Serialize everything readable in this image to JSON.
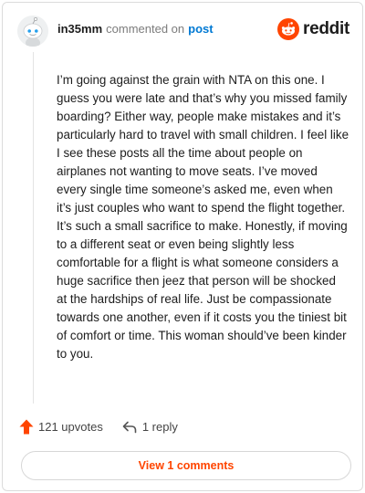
{
  "comment": {
    "username": "in35mm",
    "action_text": "commented on",
    "post_link": "post",
    "body": "I’m going against the grain with NTA on this one. I guess you were late and that’s why you missed family boarding? Either way, people make mistakes and it’s particularly hard to travel with small children. I feel like I see these posts all the time about people on airplanes not wanting to move seats. I’ve moved every single time someone’s asked me, even when it’s just couples who want to spend the flight together. It’s such a small sacrifice to make. Honestly, if moving to a different seat or even being slightly less comfortable for a flight is what someone considers a huge sacrifice then jeez that person will be shocked at the hardships of real life. Just be compassionate towards one another, even if it costs you the tiniest bit of comfort or time. This woman should’ve been kinder to you.",
    "upvotes": "121 upvotes",
    "replies": "1 reply",
    "view_comments": "View 1 comments"
  },
  "brand": {
    "name": "reddit",
    "accent": "#ff4500"
  },
  "icons": {
    "avatar": "snoo-avatar-icon",
    "logo": "reddit-logo-icon",
    "upvote": "upvote-arrow-icon",
    "reply": "reply-arrow-icon"
  }
}
